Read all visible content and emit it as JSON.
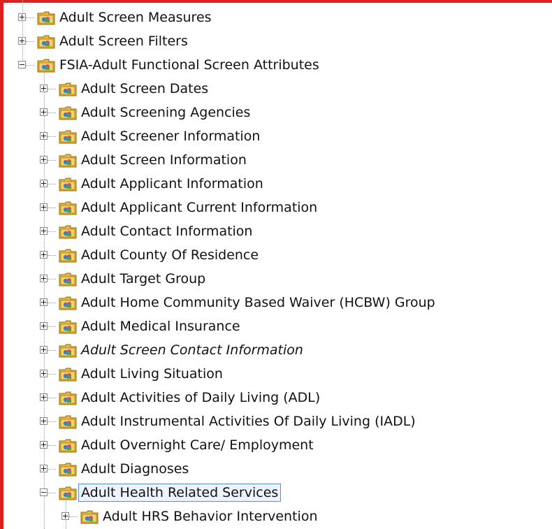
{
  "tree": {
    "nodes": [
      {
        "label": "Adult Screen Measures",
        "level": 0,
        "expanded": false
      },
      {
        "label": "Adult Screen Filters",
        "level": 0,
        "expanded": false
      },
      {
        "label": "FSIA-Adult Functional Screen Attributes",
        "level": 0,
        "expanded": true
      },
      {
        "label": "Adult Screen Dates",
        "level": 1,
        "expanded": false
      },
      {
        "label": "Adult Screening Agencies",
        "level": 1,
        "expanded": false
      },
      {
        "label": "Adult Screener Information",
        "level": 1,
        "expanded": false
      },
      {
        "label": "Adult Screen Information",
        "level": 1,
        "expanded": false
      },
      {
        "label": "Adult Applicant Information",
        "level": 1,
        "expanded": false
      },
      {
        "label": "Adult Applicant Current Information",
        "level": 1,
        "expanded": false
      },
      {
        "label": "Adult Contact Information",
        "level": 1,
        "expanded": false
      },
      {
        "label": "Adult County Of Residence",
        "level": 1,
        "expanded": false
      },
      {
        "label": "Adult Target Group",
        "level": 1,
        "expanded": false
      },
      {
        "label": "Adult Home Community Based Waiver (HCBW) Group",
        "level": 1,
        "expanded": false
      },
      {
        "label": "Adult Medical Insurance",
        "level": 1,
        "expanded": false
      },
      {
        "label": "Adult Screen Contact Information",
        "level": 1,
        "expanded": false,
        "italic": true
      },
      {
        "label": "Adult Living Situation",
        "level": 1,
        "expanded": false
      },
      {
        "label": "Adult Activities of Daily Living (ADL)",
        "level": 1,
        "expanded": false
      },
      {
        "label": "Adult Instrumental Activities Of Daily Living (IADL)",
        "level": 1,
        "expanded": false
      },
      {
        "label": "Adult Overnight Care/ Employment",
        "level": 1,
        "expanded": false
      },
      {
        "label": "Adult Diagnoses",
        "level": 1,
        "expanded": false
      },
      {
        "label": "Adult Health Related Services",
        "level": 1,
        "expanded": true,
        "selected": true
      },
      {
        "label": "Adult HRS Behavior Intervention",
        "level": 2,
        "expanded": false
      }
    ]
  },
  "colors": {
    "frame": "#e02020",
    "folder": "#e8b83a",
    "selection_border": "#5b8bd6"
  },
  "icons": {
    "node": "folder-icon",
    "expander_collapsed": "plus-box-icon",
    "expander_expanded": "minus-box-icon"
  }
}
